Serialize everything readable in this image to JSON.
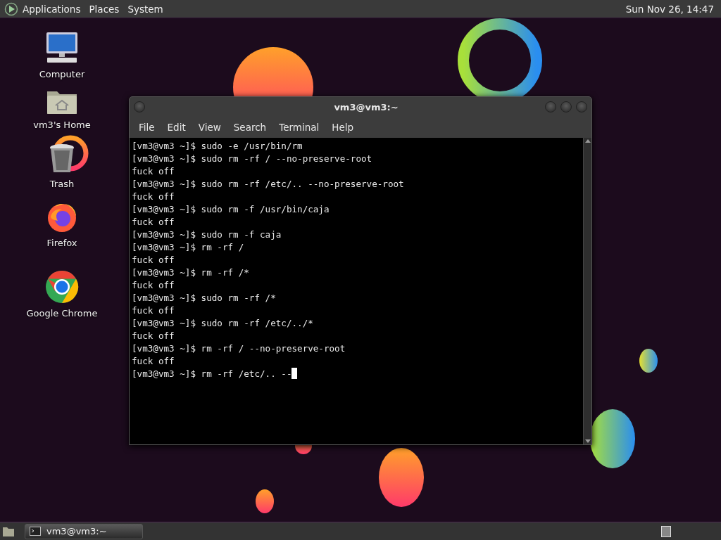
{
  "top_panel": {
    "menus": [
      "Applications",
      "Places",
      "System"
    ],
    "clock": "Sun Nov 26, 14:47"
  },
  "desktop_icons": [
    {
      "kind": "computer",
      "label": "Computer"
    },
    {
      "kind": "home",
      "label": "vm3's Home"
    },
    {
      "kind": "trash",
      "label": "Trash"
    },
    {
      "kind": "firefox",
      "label": "Firefox"
    },
    {
      "kind": "chrome",
      "label": "Google Chrome"
    }
  ],
  "terminal": {
    "title": "vm3@vm3:~",
    "menu": [
      "File",
      "Edit",
      "View",
      "Search",
      "Terminal",
      "Help"
    ],
    "lines": [
      "[vm3@vm3 ~]$ sudo -e /usr/bin/rm",
      "[vm3@vm3 ~]$ sudo rm -rf / --no-preserve-root",
      "fuck off",
      "[vm3@vm3 ~]$ sudo rm -rf /etc/.. --no-preserve-root",
      "fuck off",
      "[vm3@vm3 ~]$ sudo rm -f /usr/bin/caja",
      "fuck off",
      "[vm3@vm3 ~]$ sudo rm -f caja",
      "[vm3@vm3 ~]$ rm -rf /",
      "fuck off",
      "[vm3@vm3 ~]$ rm -rf /*",
      "fuck off",
      "[vm3@vm3 ~]$ sudo rm -rf /*",
      "fuck off",
      "[vm3@vm3 ~]$ sudo rm -rf /etc/../*",
      "fuck off",
      "[vm3@vm3 ~]$ rm -rf / --no-preserve-root",
      "fuck off",
      "[vm3@vm3 ~]$ rm -rf /etc/.. --"
    ],
    "cursor": true
  },
  "taskbar": {
    "tasks": [
      {
        "label": "vm3@vm3:~",
        "selected": true
      }
    ]
  }
}
